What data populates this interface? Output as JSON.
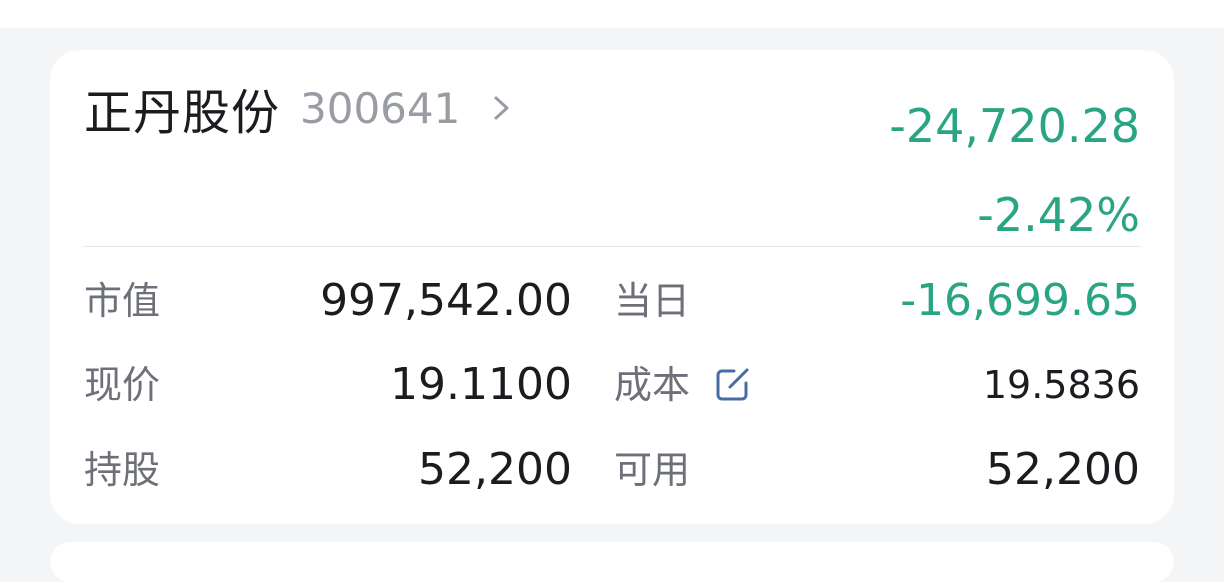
{
  "stock": {
    "name": "正丹股份",
    "code": "300641",
    "profit_loss": "-24,720.28",
    "profit_loss_pct": "-2.42%"
  },
  "rows": [
    {
      "label_left": "市值",
      "value_left": "997,542.00",
      "label_right": "当日",
      "value_right": "-16,699.65"
    },
    {
      "label_left": "现价",
      "value_left": "19.1100",
      "label_right": "成本",
      "value_right": "19.5836"
    },
    {
      "label_left": "持股",
      "value_left": "52,200",
      "label_right": "可用",
      "value_right": "52,200"
    }
  ],
  "icons": {
    "detail_chevron": "chevron-right-icon",
    "edit_cost": "edit-icon"
  },
  "colors": {
    "loss_green": "#2aa583",
    "text_primary": "#1c1c20",
    "text_secondary": "#6d7078",
    "code_gray": "#9a9ca3",
    "edit_blue": "#4a6ca3"
  }
}
